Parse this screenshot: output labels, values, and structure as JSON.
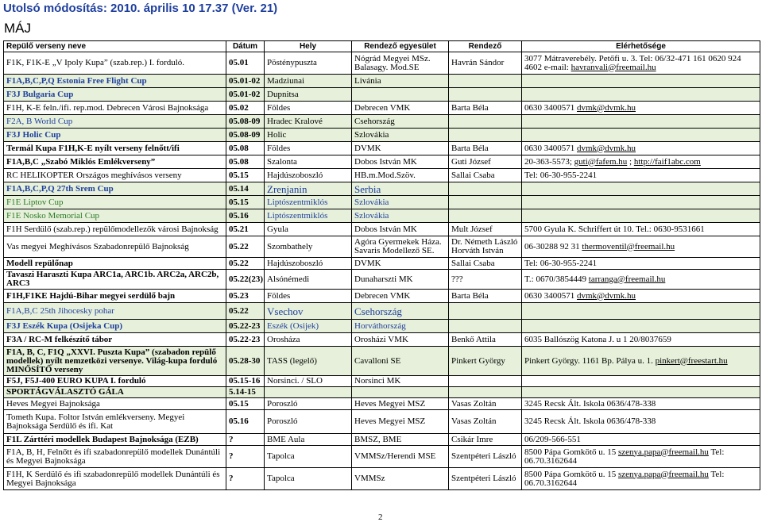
{
  "page": {
    "title": "Utolsó módosítás: 2010. április 10 17.37 (Ver. 21)",
    "section": "MÁJ",
    "page_number": "2"
  },
  "table": {
    "headers": [
      "Repülő verseny neve",
      "Dátum",
      "Hely",
      "Rendező egyesület",
      "Rendező",
      "Elérhetősége"
    ],
    "rows": [
      {
        "name": "F1K, F1K-E „V Ipoly Kupa” (szab.rep.)  I. forduló.",
        "date": "05.01",
        "place": "Pösténypuszta",
        "club": "Nógrád Megyei MSz. Balasagy. Mod.SE",
        "org": "Havrán Sándor",
        "contact": "3077 Mátraverebély. Petőfi u. 3. Tel: 06/32-471 161 0620 924 4602 e-mail: havranvali@freemail.hu",
        "style": "w",
        "h": 28
      },
      {
        "name": "F1A,B,C,P,Q Estonia Free Flight Cup",
        "date": "05.01-02",
        "place": "Madziunai",
        "club": "Livánia",
        "org": "",
        "contact": "",
        "style": "g",
        "h": 17
      },
      {
        "name": "F3J Bulgaria Cup",
        "date": "05.01-02",
        "place": "Dupnitsa",
        "club": "",
        "org": "",
        "contact": "",
        "style": "g",
        "h": 17
      },
      {
        "name": "F1H, K-E feln./ifi. rep.mod. Debrecen Városi Bajnoksága",
        "date": "05.02",
        "place": "Földes",
        "club": "Debrecen VMK",
        "org": "Barta Béla",
        "contact": "0630 3400571 dvmk@dvmk.hu",
        "style": "w",
        "h": 17
      },
      {
        "name": "F2A, B World Cup",
        "date": "05.08-09",
        "place": "Hradec Kralové",
        "club": "Csehország",
        "org": "",
        "contact": "",
        "style": "g",
        "h": 17
      },
      {
        "name": "F3J Holic Cup",
        "date": "05.08-09",
        "place": "Holic",
        "club": "Szlovákia",
        "org": "",
        "contact": "",
        "style": "g",
        "h": 17
      },
      {
        "name": "Termál Kupa F1H,K-E nyílt verseny felnőtt/ifi",
        "date": "05.08",
        "place": "Földes",
        "club": "DVMK",
        "org": "Barta Béla",
        "contact": "0630 3400571 dvmk@dvmk.hu",
        "style": "w",
        "h": 17
      },
      {
        "name": "F1A,B,C „Szabó Miklós Emlékverseny”",
        "date": "05.08",
        "place": "Szalonta",
        "club": "Dobos István MK",
        "org": "Guti József",
        "contact": "20-363-5573; guti@fafem.hu ; http://faif1abc.com",
        "style": "w",
        "h": 17
      },
      {
        "name": "RC HELIKOPTER Országos meghívásos verseny",
        "date": "05.15",
        "place": "Hajdúszoboszló",
        "club": "HB.m.Mod.Szöv.",
        "org": "Sallai Csaba",
        "contact": "Tel: 06-30-955-2241",
        "style": "w",
        "h": 17
      },
      {
        "name": "F1A,B,C,P,Q 27th Srem Cup",
        "date": "05.14",
        "place": "Zrenjanin",
        "club": "Serbia",
        "org": "",
        "contact": "",
        "style": "g",
        "h": 17
      },
      {
        "name": "F1E Liptov Cup",
        "date": "05.15",
        "place": "Liptószentmiklós",
        "club": "Szlovákia",
        "org": "",
        "contact": "",
        "style": "g",
        "h": 17
      },
      {
        "name": "F1E Nosko Memorial Cup",
        "date": "05.16",
        "place": "Liptószentmiklós",
        "club": "Szlovákia",
        "org": "",
        "contact": "",
        "style": "g",
        "h": 17
      },
      {
        "name": "F1H Serdülő (szab.rep.) repülőmodellezők városi Bajnokság",
        "date": "05.21",
        "place": "Gyula",
        "club": "Dobos István MK",
        "org": "Mult József",
        "contact": "5700 Gyula K. Schriffert út 10. Tel.: 0630-9531661",
        "style": "w",
        "h": 17
      },
      {
        "name": "Vas megyei Meghívásos Szabadonrepülő Bajnokság",
        "date": "05.22",
        "place": "Szombathely",
        "club": "Agóra Gyermekek Háza. Savaris Modellező SE.",
        "org": "Dr. Németh László Horváth István",
        "contact": "06-30288 92 31       thermoventil@freemail.hu",
        "style": "w",
        "h": 27
      },
      {
        "name": "Modell repülőnap",
        "date": "05.22",
        "place": "Hajdúszoboszló",
        "club": "DVMK",
        "org": "Sallai Csaba",
        "contact": "Tel: 06-30-955-2241",
        "style": "w",
        "h": 15
      },
      {
        "name": "Tavaszi Haraszti Kupa ARC1a, ARC1b. ARC2a, ARC2b, ARC3",
        "date": "05.22(23)",
        "place": "Alsónémedi",
        "club": "Dunaharszti MK",
        "org": "???",
        "contact": "T.: 0670/3854449 tarranga@freemail.hu",
        "style": "w",
        "h": 25
      },
      {
        "name": "F1H,F1KE Hajdú-Bihar megyei serdülő bajn",
        "date": "05.23",
        "place": "Földes",
        "club": "Debrecen VMK",
        "org": "Barta Béla",
        "contact": "0630 3400571 dvmk@dvmk.hu",
        "style": "w",
        "h": 17
      },
      {
        "name": "F1A,B,C  25th Jihocesky pohar",
        "date": "05.22",
        "place": "Vsechov",
        "club": "Csehország",
        "org": "",
        "contact": "",
        "style": "g",
        "h": 21
      },
      {
        "name": "F3J Eszék Kupa (Osijeka Cup)",
        "date": "05.22-23",
        "place": "Eszék (Osijek)",
        "club": "Horváthország",
        "org": "",
        "contact": "",
        "style": "g",
        "h": 17
      },
      {
        "name": "F3A / RC-M felkészítő tábor",
        "date": "05.22-23",
        "place": "Orosháza",
        "club": "Orosházi VMK",
        "org": "Benkő Attila",
        "contact": "6035 Ballószög Katona J. u 1 20/8037659",
        "style": "w",
        "h": 17
      },
      {
        "name": "F1A, B, C, F1Q „XXVI. Puszta Kupa” (szabadon repülő modellek) nyílt nemzetközi versenye. Világ-kupa forduló MINŐSÍTŐ verseny",
        "date": "05.28-30",
        "place": "TASS (legelő)",
        "club": "Cavalloni SE",
        "org": "Pinkert György",
        "contact": "Pinkert György. 1161 Bp. Pálya u. 1. pinkert@freestart.hu",
        "style": "g",
        "h": 37
      },
      {
        "name": "F5J, F5J-400 EURO KUPA I. forduló",
        "date": "05.15-16",
        "place": "Norsinci. / SLO",
        "club": "Norsinci MK",
        "org": "",
        "contact": "",
        "style": "w",
        "h": 14
      },
      {
        "name": "SPORTÁGVÁLASZTÓ GÁLA",
        "date": "5.14-15",
        "place": "",
        "club": "",
        "org": "",
        "contact": "",
        "style": "g",
        "h": 14
      },
      {
        "name": "Heves Megyei Bajnoksága",
        "date": "05.15",
        "place": "Poroszló",
        "club": "Heves Megyei MSZ",
        "org": "Vasas Zoltán",
        "contact": "3245 Recsk Ált. Iskola 0636/478-338",
        "style": "w",
        "h": 15
      },
      {
        "name": "Tometh Kupa. Foltor István emlékverseny. Megyei Bajnoksága Serdülő és ifi. Kat",
        "date": "05.16",
        "place": "Poroszló",
        "club": "Heves Megyei MSZ",
        "org": "Vasas Zoltán",
        "contact": "3245 Recsk Ált. Iskola 0636/478-338",
        "style": "w",
        "h": 30
      },
      {
        "name": "F1L Zárttéri modellek Budapest Bajnoksága (EZB)",
        "date": "?",
        "place": "BME Aula",
        "club": "BMSZ, BME",
        "org": "Csikár Imre",
        "contact": "06/209-566-551",
        "style": "w",
        "h": 15
      },
      {
        "name": "F1A, B, H, Felnőtt és ifi szabadonrepülő modellek Dunántúli és Megyei Bajnoksága",
        "date": "?",
        "place": "Tapolca",
        "club": "VMMSz/Herendi MSE",
        "org": "Szentpéteri László",
        "contact": "8500 Pápa Gomkötő u. 15 szenya.papa@freemail.hu Tel: 06.70.3162644",
        "style": "w",
        "h": 28
      },
      {
        "name": "F1H, K Serdülő és ifi szabadonrepülő modellek Dunántúli és Megyei Bajnoksága",
        "date": "?",
        "place": "Tapolca",
        "club": "VMMSz",
        "org": "Szentpéteri László",
        "contact": "8500 Pápa Gomkötő u. 15 szenya.papa@freemail.hu Tel: 06.70.3162644",
        "style": "w",
        "h": 28
      }
    ]
  }
}
